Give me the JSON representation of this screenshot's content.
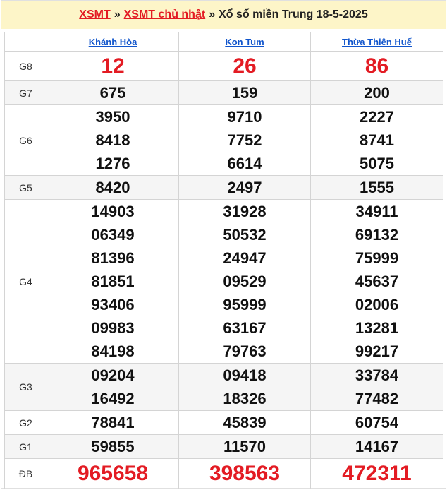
{
  "breadcrumb": {
    "link1": "XSMT",
    "sep1": "»",
    "link2": "XSMT chủ nhật",
    "sep2": "»",
    "current": "Xổ số miền Trung 18-5-2025"
  },
  "provinces": [
    "Khánh Hòa",
    "Kon Tum",
    "Thừa Thiên Huế"
  ],
  "prizes": [
    {
      "label": "G8",
      "values": [
        [
          "12"
        ],
        [
          "26"
        ],
        [
          "86"
        ]
      ]
    },
    {
      "label": "G7",
      "values": [
        [
          "675"
        ],
        [
          "159"
        ],
        [
          "200"
        ]
      ]
    },
    {
      "label": "G6",
      "values": [
        [
          "3950",
          "8418",
          "1276"
        ],
        [
          "9710",
          "7752",
          "6614"
        ],
        [
          "2227",
          "8741",
          "5075"
        ]
      ]
    },
    {
      "label": "G5",
      "values": [
        [
          "8420"
        ],
        [
          "2497"
        ],
        [
          "1555"
        ]
      ]
    },
    {
      "label": "G4",
      "values": [
        [
          "14903",
          "06349",
          "81396",
          "81851",
          "93406",
          "09983",
          "84198"
        ],
        [
          "31928",
          "50532",
          "24947",
          "09529",
          "95999",
          "63167",
          "79763"
        ],
        [
          "34911",
          "69132",
          "75999",
          "45637",
          "02006",
          "13281",
          "99217"
        ]
      ]
    },
    {
      "label": "G3",
      "values": [
        [
          "09204",
          "16492"
        ],
        [
          "09418",
          "18326"
        ],
        [
          "33784",
          "77482"
        ]
      ]
    },
    {
      "label": "G2",
      "values": [
        [
          "78841"
        ],
        [
          "45839"
        ],
        [
          "60754"
        ]
      ]
    },
    {
      "label": "G1",
      "values": [
        [
          "59855"
        ],
        [
          "11570"
        ],
        [
          "14167"
        ]
      ]
    },
    {
      "label": "ĐB",
      "values": [
        [
          "965658"
        ],
        [
          "398563"
        ],
        [
          "472311"
        ]
      ]
    }
  ],
  "colors": {
    "accent": "#e31b23",
    "link": "#1155cc",
    "header_bg": "#fdf5c8",
    "alt_row": "#f5f5f5"
  }
}
